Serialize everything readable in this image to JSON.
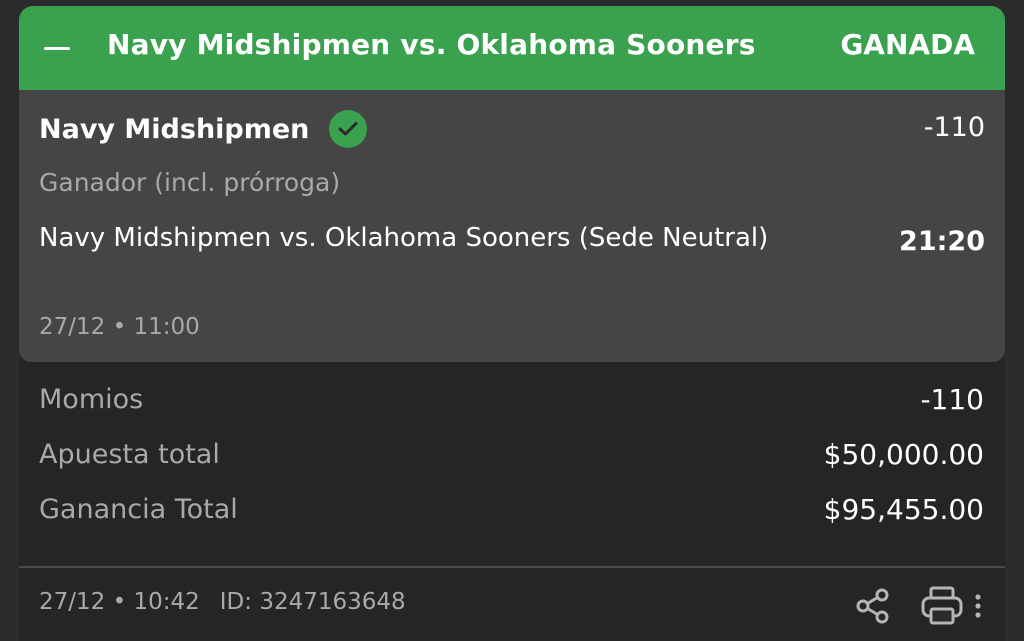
{
  "header": {
    "title": "Navy Midshipmen vs. Oklahoma Sooners",
    "status": "GANADA",
    "status_color": "#3aa14f",
    "collapse_icon": "minus-icon"
  },
  "selection": {
    "team": "Navy Midshipmen",
    "won_icon": "check-circle-icon",
    "odds": "-110",
    "market": "Ganador (incl. prórroga)",
    "event": "Navy Midshipmen vs. Oklahoma Sooners (Sede Neutral)",
    "score": "21:20",
    "event_date": "27/12 • 11:00"
  },
  "summary": {
    "rows": [
      {
        "label": "Momios",
        "value": "-110"
      },
      {
        "label": "Apuesta total",
        "value": "$50,000.00"
      },
      {
        "label": "Ganancia Total",
        "value": "$95,455.00"
      }
    ]
  },
  "footer": {
    "placed_at": "27/12 • 10:42",
    "bet_id": "ID: 3247163648",
    "icons": [
      "share-icon",
      "print-icon",
      "more-vertical-icon"
    ]
  }
}
